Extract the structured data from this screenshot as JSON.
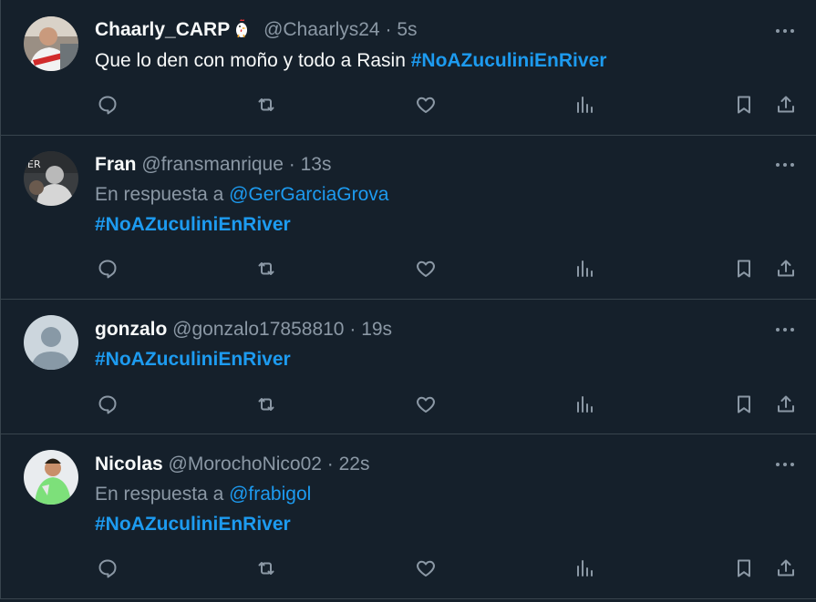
{
  "tweets": [
    {
      "name": "Chaarly_CARP",
      "handle": "@Chaarlys24",
      "sep": "·",
      "time": "5s",
      "emoji": "chicken-icon",
      "text_prefix": "Que lo den con moño y todo a Rasin ",
      "hashtag": "#NoAZuculiniEnRiver",
      "avatar": "avatar-photo-red-white-jersey"
    },
    {
      "name": "Fran",
      "handle": "@fransmanrique",
      "sep": "·",
      "time": "13s",
      "reply_label": "En respuesta a ",
      "reply_to": "@GerGarciaGrova",
      "hashtag": "#NoAZuculiniEnRiver",
      "avatar": "avatar-photo-hoodie"
    },
    {
      "name": "gonzalo",
      "handle": "@gonzalo17858810",
      "sep": "·",
      "time": "19s",
      "hashtag": "#NoAZuculiniEnRiver",
      "avatar": "avatar-default"
    },
    {
      "name": "Nicolas",
      "handle": "@MorochoNico02",
      "sep": "·",
      "time": "22s",
      "reply_label": "En respuesta a ",
      "reply_to": "@frabigol",
      "hashtag": "#NoAZuculiniEnRiver",
      "avatar": "avatar-photo-green-jersey"
    }
  ],
  "icons": {
    "more": "more-icon",
    "reply": "reply-icon",
    "retweet": "retweet-icon",
    "like": "heart-icon",
    "views": "analytics-icon",
    "bookmark": "bookmark-icon",
    "share": "share-icon"
  },
  "colors": {
    "background": "#15202b",
    "border": "#38444d",
    "text": "#f7f9f9",
    "secondary": "#8b98a5",
    "accent": "#1d9bf0"
  }
}
